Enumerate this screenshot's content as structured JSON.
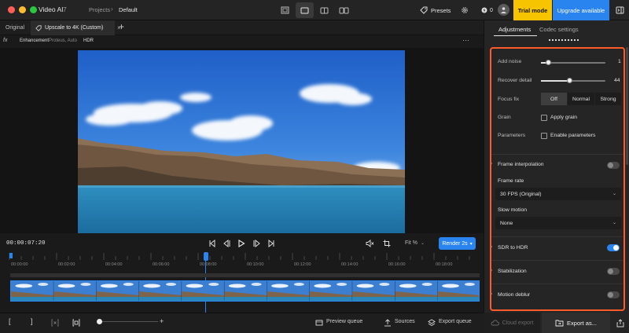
{
  "window": {
    "app_name": "Video AI",
    "app_version": "7",
    "breadcrumb": [
      "Projects",
      "Default"
    ],
    "breadcrumb_sep": "›"
  },
  "header": {
    "presets_label": "Presets",
    "credits": "0",
    "trial_label": "Trial mode",
    "upgrade_label": "Upgrade available"
  },
  "tabs": {
    "original_label": "Original",
    "active_label": "Upscale to 4K (Custom)",
    "close_glyph": "×",
    "add_glyph": "+"
  },
  "subbar": {
    "fx": "fx",
    "enhancement_label": "Enhancement",
    "enhancement_value": "Proteus, Auto",
    "hdr_label": "HDR",
    "more": "···"
  },
  "controls": {
    "timecode": "00:00:07:20",
    "fit_label": "Fit %",
    "render_label": "Render 2s"
  },
  "timeline": {
    "ticks": [
      "00:00:00",
      "00:02:00",
      "00:04:00",
      "00:06:00",
      "00:08:00",
      "00:10:00",
      "00:12:00",
      "00:14:00",
      "00:16:00",
      "00:18:00"
    ],
    "playhead_fraction": 0.415,
    "filmstrip_frames": 11
  },
  "bottom": {
    "preview_queue": "Preview queue",
    "sources": "Sources",
    "export_queue": "Export queue",
    "bracket_left": "[",
    "bracket_right": "]",
    "zoom_plus": "+"
  },
  "panel": {
    "tab_adjustments": "Adjustments",
    "tab_codec": "Codec settings",
    "add_noise_label": "Add noise",
    "add_noise_value": "1",
    "add_noise_fraction": 0.12,
    "recover_detail_label": "Recover detail",
    "recover_detail_value": "44",
    "recover_detail_fraction": 0.44,
    "focus_fix_label": "Focus fix",
    "focus_fix_options": [
      "Off",
      "Normal",
      "Strong"
    ],
    "focus_fix_selected": "Off",
    "grain_label": "Grain",
    "grain_checkbox": "Apply grain",
    "parameters_label": "Parameters",
    "parameters_checkbox": "Enable parameters",
    "frame_interpolation": "Frame interpolation",
    "frame_rate_label": "Frame rate",
    "frame_rate_value": "30 FPS (Original)",
    "slow_motion_label": "Slow motion",
    "slow_motion_value": "None",
    "sdr_to_hdr": "SDR to HDR",
    "sdr_to_hdr_on": true,
    "stabilization": "Stabilization",
    "motion_deblur": "Motion deblur",
    "cloud_export": "Cloud export",
    "export_as": "Export as...",
    "highlight_color": "#ff5a2a"
  },
  "colors": {
    "accent": "#2a84f0",
    "trial": "#f6c400"
  }
}
